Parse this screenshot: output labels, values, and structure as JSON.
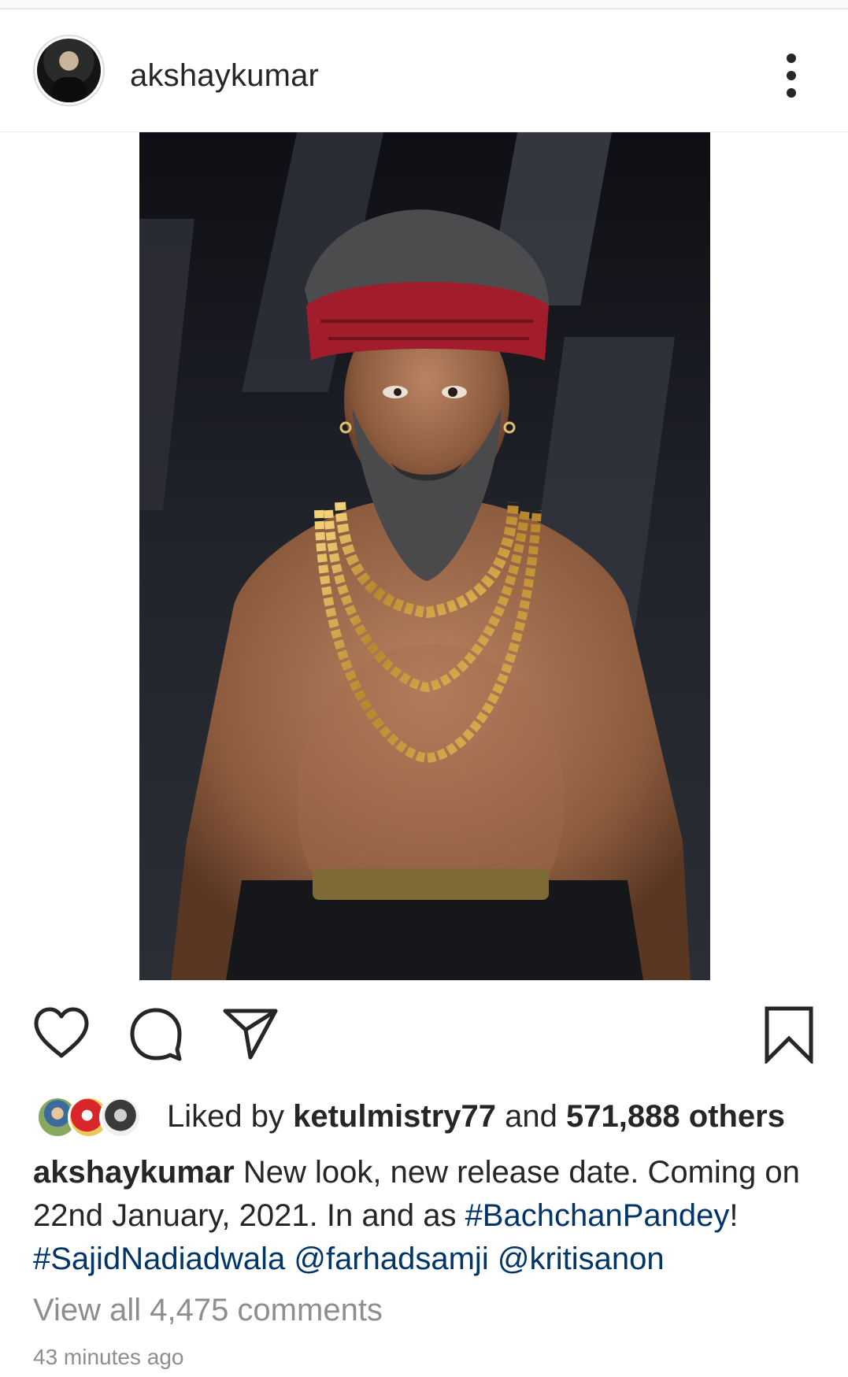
{
  "post": {
    "username": "akshaykumar",
    "avatar_icon": "profile-avatar",
    "more_icon": "more-options-icon",
    "image_alt": "Poster: bearded man with red bandana and gold chains"
  },
  "actions": {
    "like_icon": "heart-icon",
    "comment_icon": "comment-icon",
    "share_icon": "send-icon",
    "save_icon": "bookmark-icon"
  },
  "likes": {
    "prefix": "Liked by ",
    "user": "ketulmistry77",
    "middle": " and ",
    "count": "571,888 others"
  },
  "caption": {
    "username": "akshaykumar",
    "text_1": " New look, new release date. Coming on 22nd January, 2021. In and as ",
    "hashtag_1": "#BachchanPandey",
    "text_2": "! ",
    "hashtag_2": "#SajidNadiadwala",
    "space_1": " ",
    "mention_1": "@farhadsamji",
    "space_2": " ",
    "mention_2": "@kritisanon"
  },
  "comments": {
    "view_all": "View all 4,475 comments"
  },
  "timestamp": "43 minutes ago",
  "colors": {
    "text": "#262626",
    "muted": "#8e8e8e",
    "link": "#003569",
    "divider": "#e8e8e8"
  }
}
